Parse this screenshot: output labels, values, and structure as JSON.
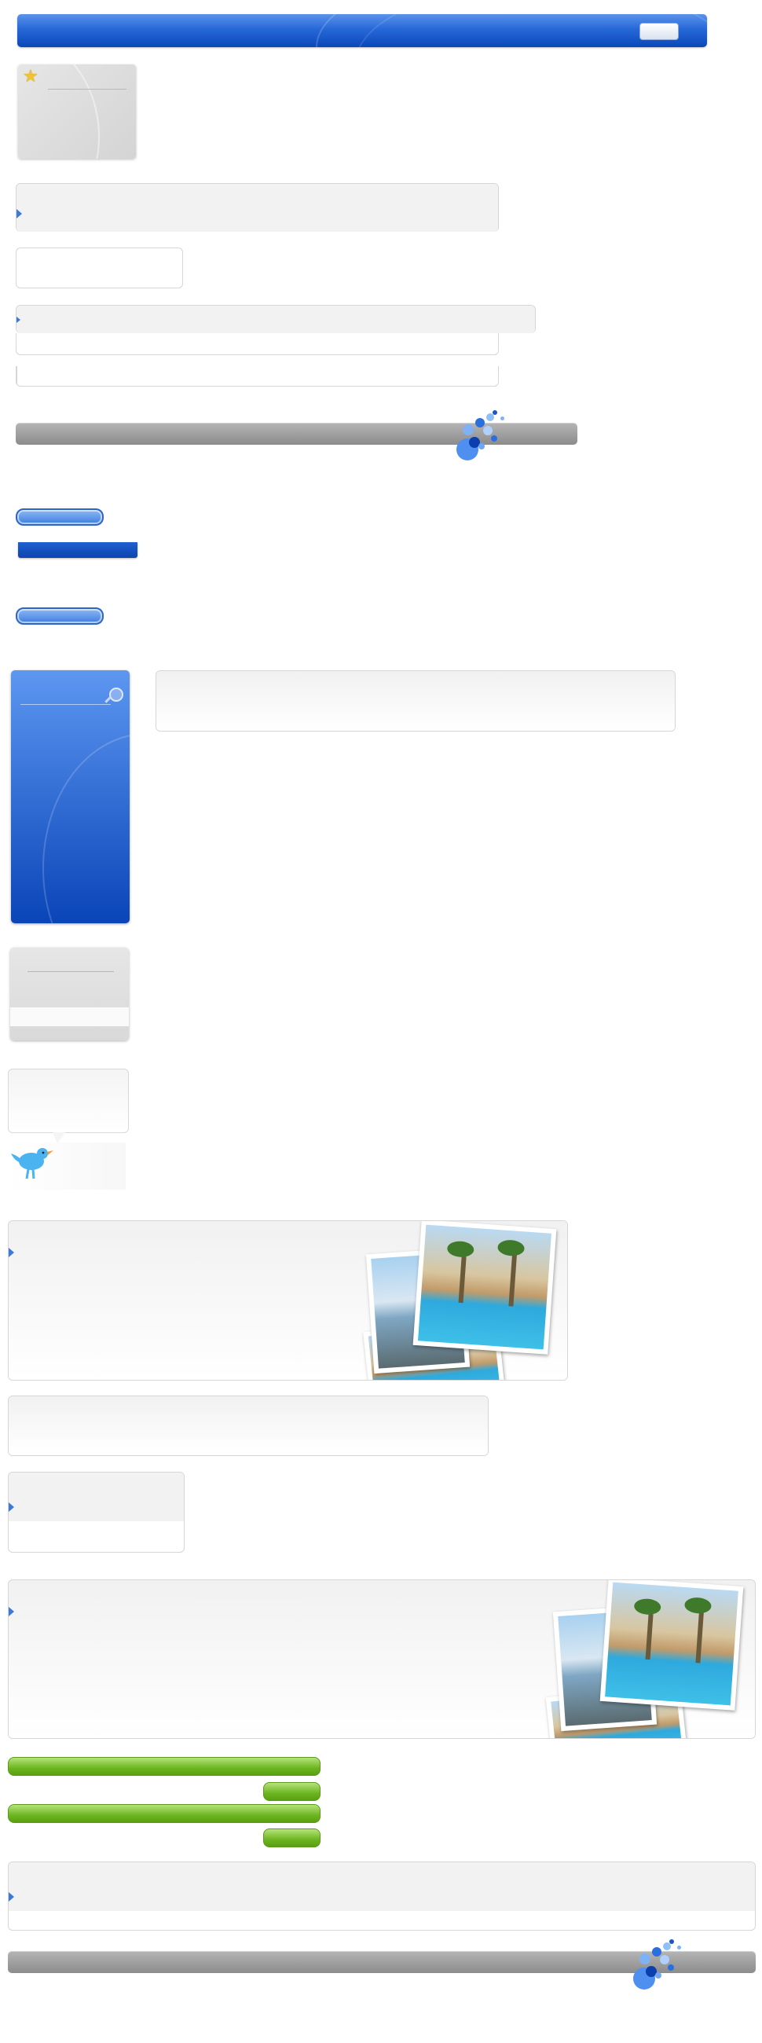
{
  "header": {
    "button_label": ""
  },
  "icons": {
    "star": "star-icon",
    "search": "magnifier-icon",
    "bird": "twitter-bird-icon",
    "arrow": "triangle-right-icon"
  },
  "colors": {
    "accent_blue": "#1b5bd0",
    "green": "#6cb520",
    "gray_bar": "#9a9a9a",
    "bird": "#4ab3f0"
  }
}
